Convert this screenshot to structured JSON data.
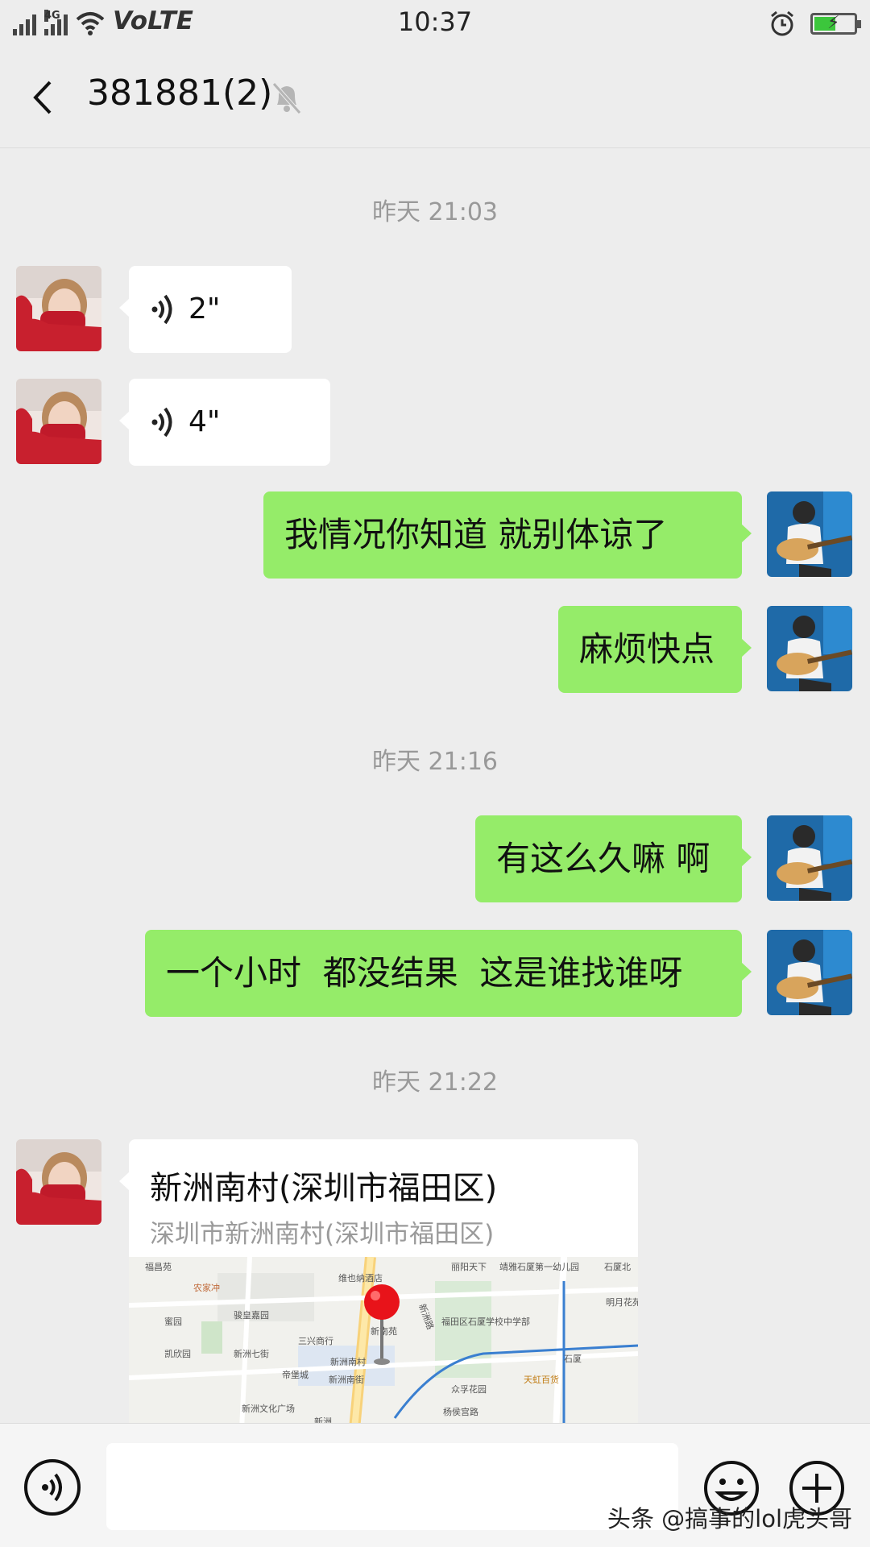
{
  "status_bar": {
    "network_tag": "4G",
    "carrier_label": "VoLTE",
    "time": "10:37",
    "battery_level": 0.55,
    "colors": {
      "battery": "#3cc63c"
    }
  },
  "header": {
    "title": "381881(2)",
    "back_icon": "chevron-left-icon",
    "mute_icon": "bell-off-icon"
  },
  "messages": {
    "ts1": "昨天 21:03",
    "voice1": "2\"",
    "voice2": "4\"",
    "out1": "我情况你知道 就别体谅了",
    "out2": "麻烦快点",
    "ts2": "昨天 21:16",
    "out3": "有这么久嘛 啊",
    "out4": "一个小时  都没结果  这是谁找谁呀",
    "ts3": "昨天 21:22",
    "location": {
      "title": "新洲南村(深圳市福田区)",
      "address": "深圳市新洲南村(深圳市福田区)",
      "map_labels": {
        "l1": "福昌苑",
        "l2": "农家冲",
        "l3": "维也纳酒店",
        "l4": "丽阳天下",
        "l5": "靖雅石厦第一幼儿园",
        "l6": "石厦北",
        "l7": "明月花苑",
        "l8": "蜜园",
        "l9": "骏皇嘉园",
        "l10": "福田区石厦学校中学部",
        "l11": "三兴商行",
        "l12": "新南苑",
        "l13": "新洲七街",
        "l14": "凯欣园",
        "l15": "帝堡城",
        "l16": "新洲南村",
        "l17": "新洲南街",
        "l18": "众孚花园",
        "l19": "天虹百货",
        "l20": "新洲文化广场",
        "l21": "新洲",
        "l22": "杨侯宫路",
        "l23": "石厦",
        "l24": "新洲路"
      }
    }
  },
  "input_bar": {
    "voice_icon": "voice-mode-icon",
    "emoji_icon": "emoji-icon",
    "plus_icon": "plus-icon"
  },
  "watermark": "头条 @搞事的lol虎头哥",
  "colors": {
    "incoming_bubble": "#ffffff",
    "outgoing_bubble": "#95ec69",
    "background": "#ededed"
  }
}
